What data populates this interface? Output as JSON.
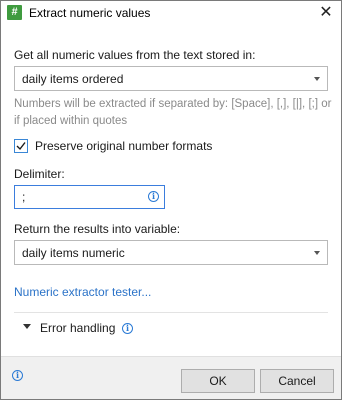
{
  "window": {
    "icon_glyph": "#",
    "title": "Extract numeric values",
    "close_glyph": "✕"
  },
  "source": {
    "label": "Get all numeric values from the text stored in:",
    "selected": "daily items ordered",
    "hint": "Numbers will be extracted if separated by: [Space], [,], [|], [;] or if placed within quotes"
  },
  "preserve": {
    "label": "Preserve original number formats",
    "checked": true
  },
  "delimiter": {
    "label": "Delimiter:",
    "value": ";"
  },
  "result": {
    "label": "Return the results into variable:",
    "selected": "daily items numeric"
  },
  "tester_link": "Numeric extractor tester...",
  "error_handling": {
    "label": "Error handling"
  },
  "footer": {
    "ok_label": "OK",
    "cancel_label": "Cancel"
  },
  "icons": {
    "app": "hash-icon",
    "close": "close-icon",
    "info": "info-icon",
    "check": "checkmark-icon",
    "caret": "chevron-down-icon"
  },
  "colors": {
    "accent": "#2a7ad5",
    "link": "#2b73c8",
    "app_icon": "#3f9b3f",
    "hint": "#8a8a8a"
  }
}
